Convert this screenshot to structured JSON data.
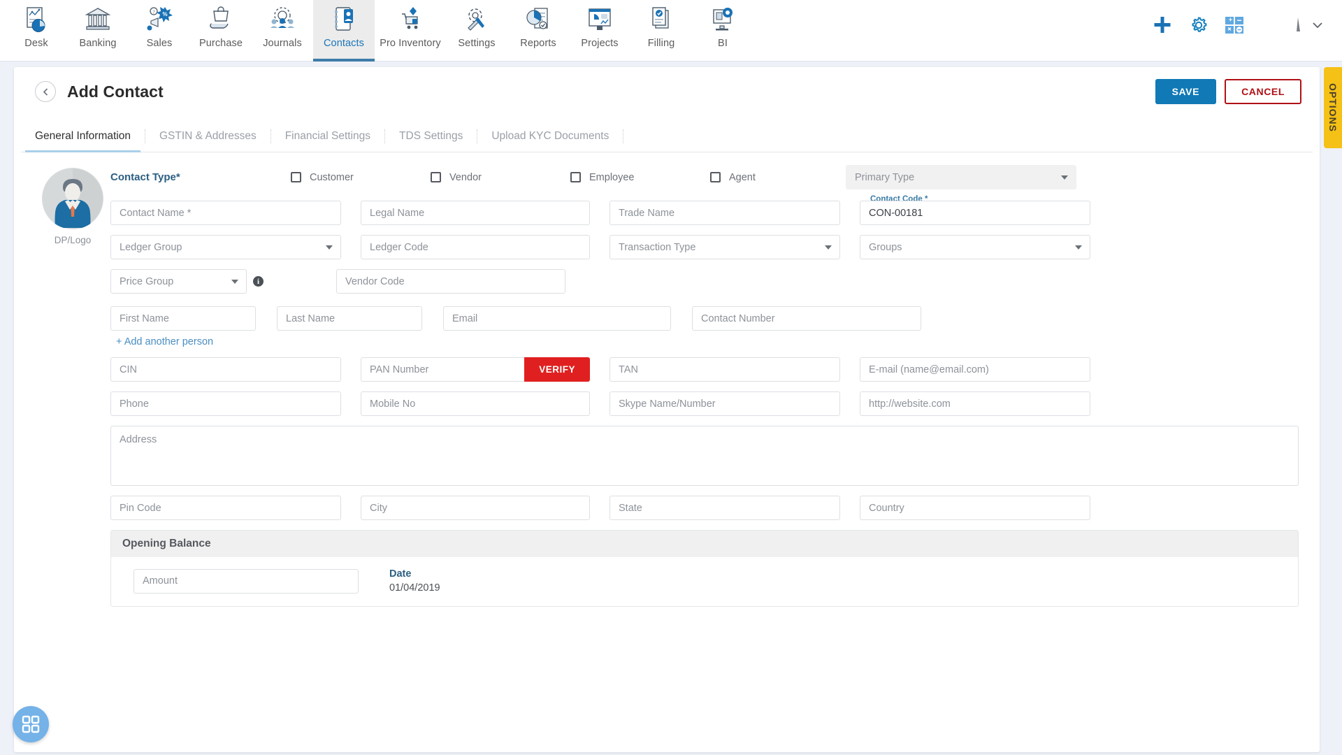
{
  "topnav": {
    "items": [
      {
        "label": "Desk",
        "icon": "desk-chart-icon"
      },
      {
        "label": "Banking",
        "icon": "bank-building-icon"
      },
      {
        "label": "Sales",
        "icon": "sales-megaphone-icon"
      },
      {
        "label": "Purchase",
        "icon": "purchase-bag-hand-icon"
      },
      {
        "label": "Journals",
        "icon": "journals-people-gear-icon"
      },
      {
        "label": "Contacts",
        "icon": "contacts-card-icon"
      },
      {
        "label": "Pro Inventory",
        "icon": "inventory-cart-icon"
      },
      {
        "label": "Settings",
        "icon": "settings-tools-icon"
      },
      {
        "label": "Reports",
        "icon": "reports-piechart-icon"
      },
      {
        "label": "Projects",
        "icon": "projects-dashboard-icon"
      },
      {
        "label": "Filling",
        "icon": "filling-documents-icon"
      },
      {
        "label": "BI",
        "icon": "bi-monitor-gear-icon"
      }
    ],
    "active": "Contacts",
    "actions": [
      {
        "name": "add-icon",
        "label": "Add"
      },
      {
        "name": "gear-icon",
        "label": "Settings"
      },
      {
        "name": "calculator-icon",
        "label": "Calculator"
      }
    ],
    "user": {
      "avatar": "user-avatar",
      "chevron": "chevron-down-icon"
    }
  },
  "header": {
    "back_icon": "chevron-left-icon",
    "title": "Add Contact",
    "save_label": "SAVE",
    "cancel_label": "CANCEL"
  },
  "options_tab": {
    "label": "OPTIONS"
  },
  "tabs": [
    {
      "label": "General Information",
      "active": true
    },
    {
      "label": "GSTIN & Addresses",
      "active": false
    },
    {
      "label": "Financial Settings",
      "active": false
    },
    {
      "label": "TDS Settings",
      "active": false
    },
    {
      "label": "Upload KYC Documents",
      "active": false
    }
  ],
  "avatar": {
    "caption": "DP/Logo"
  },
  "contact_type": {
    "label": "Contact Type*",
    "options": [
      {
        "label": "Customer",
        "checked": false
      },
      {
        "label": "Vendor",
        "checked": false
      },
      {
        "label": "Employee",
        "checked": false
      },
      {
        "label": "Agent",
        "checked": false
      }
    ]
  },
  "fields": {
    "primary_type": {
      "placeholder": "Primary Type",
      "value": ""
    },
    "contact_name": {
      "placeholder": "Contact Name *",
      "value": ""
    },
    "legal_name": {
      "placeholder": "Legal Name",
      "value": ""
    },
    "trade_name": {
      "placeholder": "Trade Name",
      "value": ""
    },
    "contact_code": {
      "label": "Contact Code *",
      "value": "CON-00181"
    },
    "ledger_group": {
      "placeholder": "Ledger Group",
      "value": ""
    },
    "ledger_code": {
      "placeholder": "Ledger Code",
      "value": ""
    },
    "transaction_type": {
      "placeholder": "Transaction Type",
      "value": ""
    },
    "groups": {
      "placeholder": "Groups",
      "value": ""
    },
    "price_group": {
      "placeholder": "Price Group",
      "value": ""
    },
    "vendor_code": {
      "placeholder": "Vendor Code",
      "value": ""
    },
    "first_name": {
      "placeholder": "First Name",
      "value": ""
    },
    "last_name": {
      "placeholder": "Last Name",
      "value": ""
    },
    "email": {
      "placeholder": "Email",
      "value": ""
    },
    "contact_number": {
      "placeholder": "Contact Number",
      "value": ""
    },
    "add_person_link": "+ Add another person",
    "cin": {
      "placeholder": "CIN",
      "value": ""
    },
    "pan_number": {
      "placeholder": "PAN Number",
      "value": ""
    },
    "verify_label": "VERIFY",
    "tan": {
      "placeholder": "TAN",
      "value": ""
    },
    "email2": {
      "placeholder": "E-mail (name@email.com)",
      "value": ""
    },
    "phone": {
      "placeholder": "Phone",
      "value": ""
    },
    "mobile_no": {
      "placeholder": "Mobile No",
      "value": ""
    },
    "skype": {
      "placeholder": "Skype Name/Number",
      "value": ""
    },
    "website": {
      "placeholder": "http://website.com",
      "value": ""
    },
    "address": {
      "placeholder": "Address",
      "value": ""
    },
    "pin_code": {
      "placeholder": "Pin Code",
      "value": ""
    },
    "city": {
      "placeholder": "City",
      "value": ""
    },
    "state": {
      "placeholder": "State",
      "value": ""
    },
    "country": {
      "placeholder": "Country",
      "value": ""
    }
  },
  "opening_balance": {
    "title": "Opening Balance",
    "amount": {
      "placeholder": "Amount",
      "value": ""
    },
    "date_label": "Date",
    "date_value": "01/04/2019"
  },
  "fab": {
    "icon": "grid-apps-icon"
  },
  "colors": {
    "accent_blue": "#1179b5",
    "danger_red": "#b01116",
    "verify_red": "#e02020",
    "options_yellow": "#f5c117",
    "label_blue": "#2b5f82",
    "link_blue": "#4a8ec2"
  }
}
